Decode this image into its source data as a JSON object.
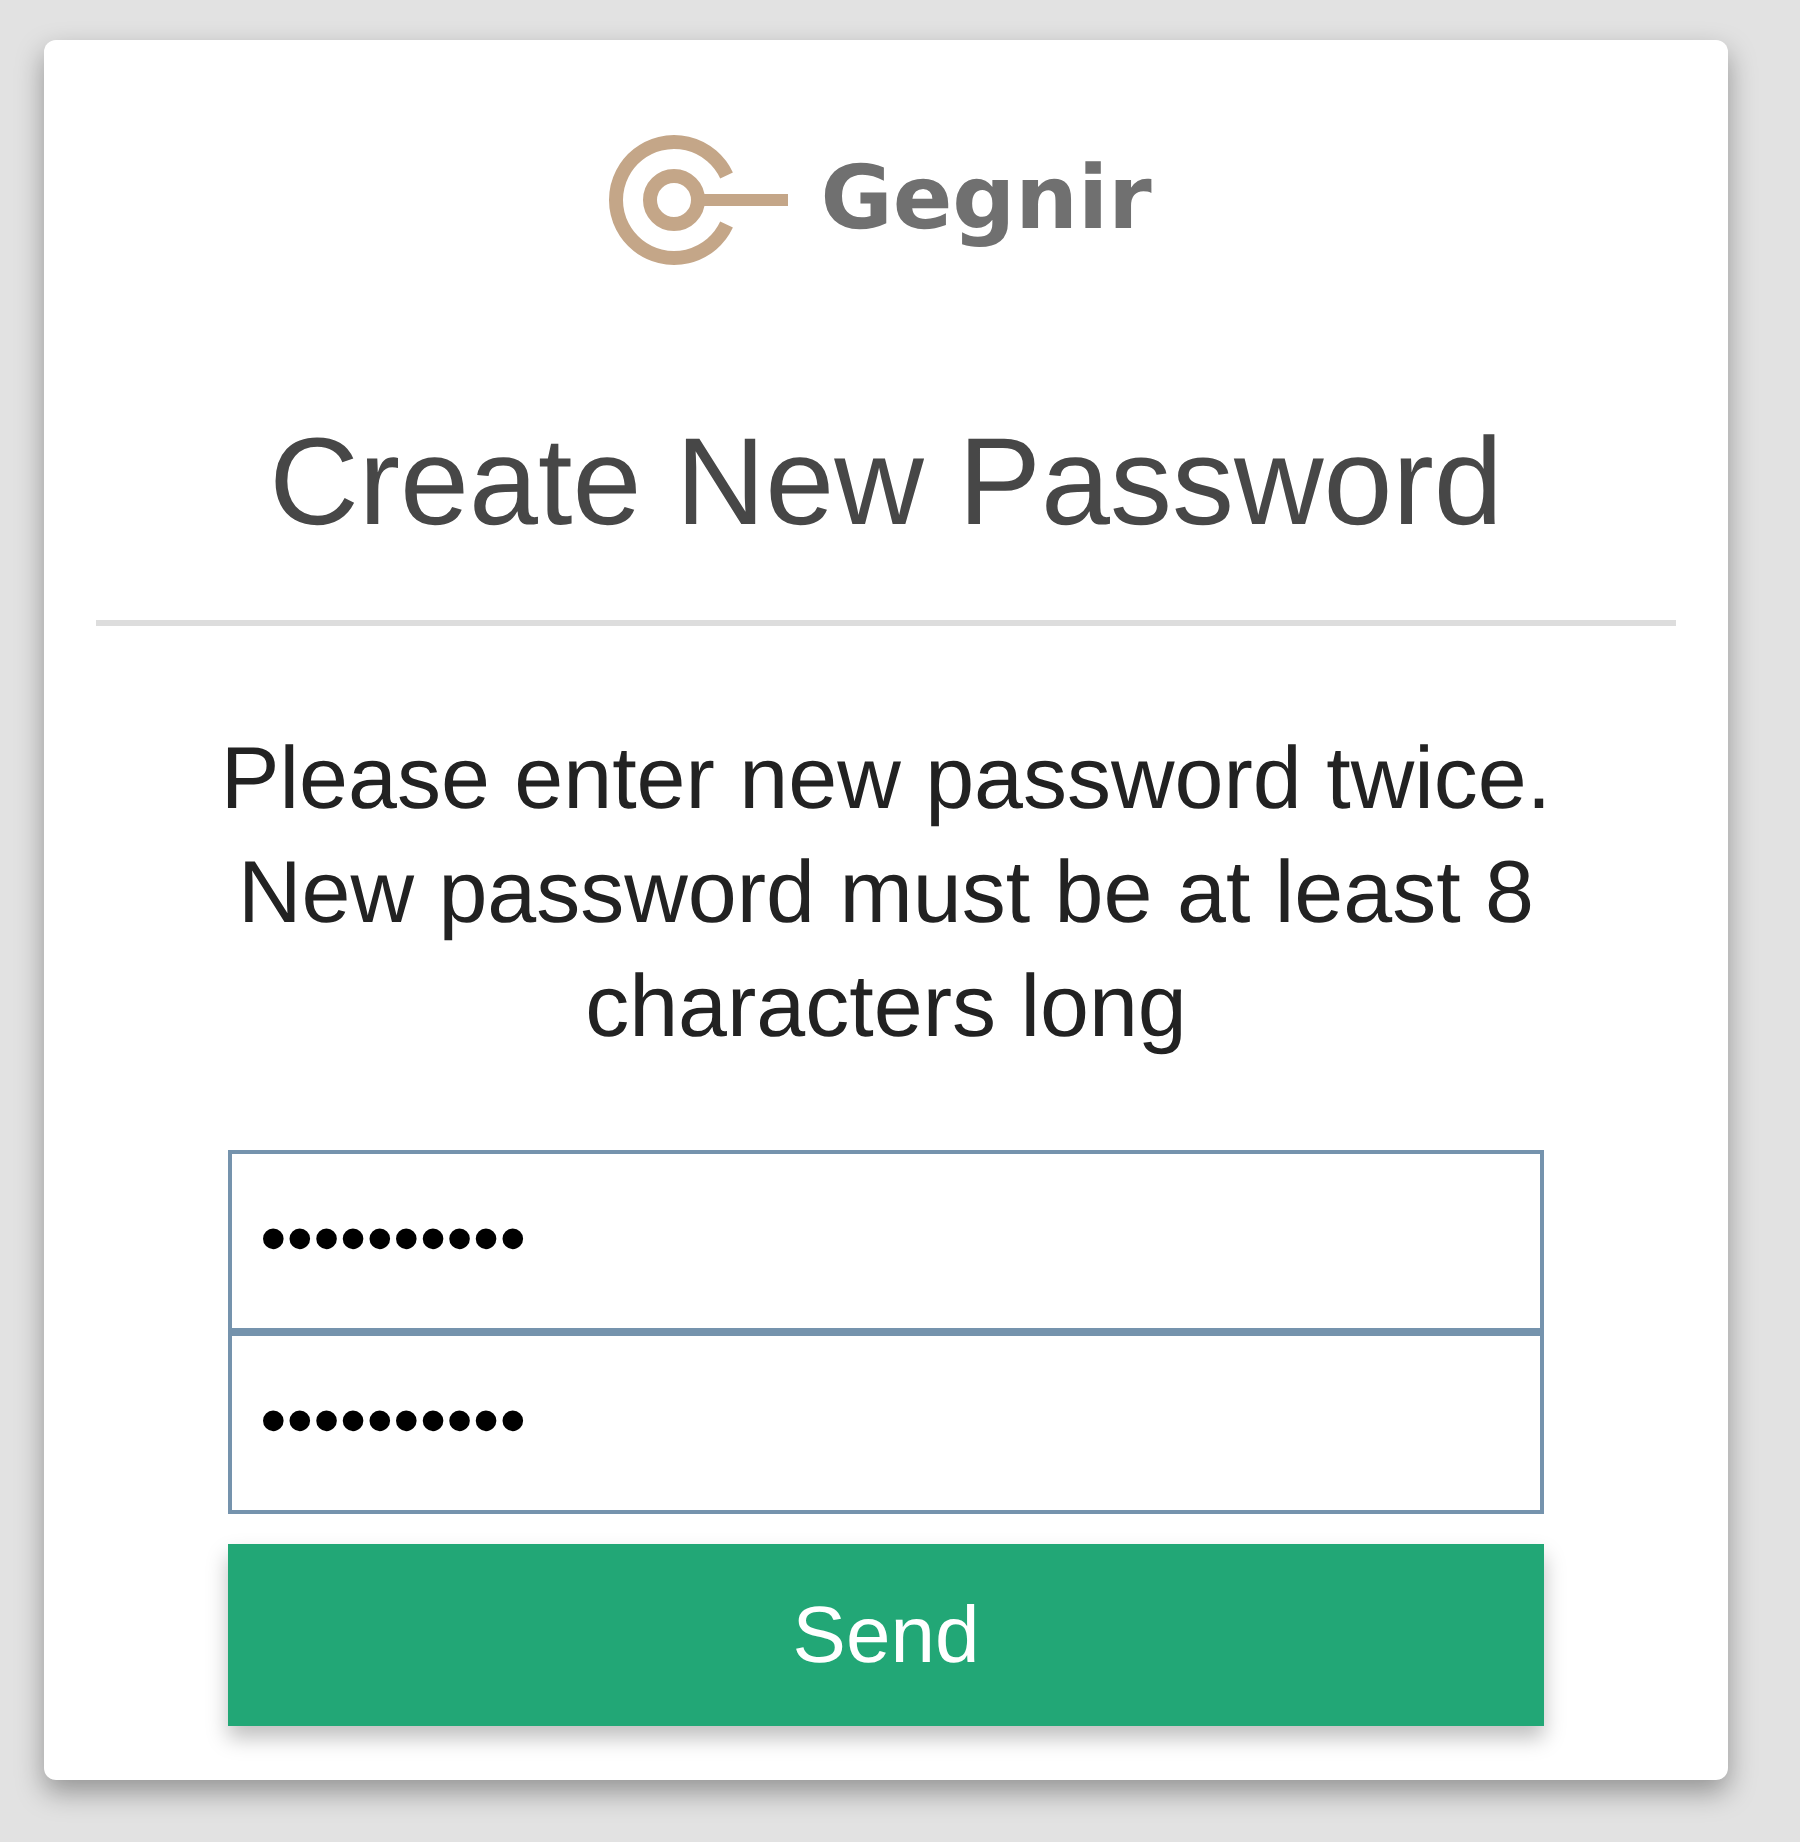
{
  "logo": {
    "name": "Gegnir"
  },
  "title": "Create New Password",
  "instructions": "Please enter new password twice. New password must be at least 8 characters long",
  "fields": [
    {
      "value": "••••••••••"
    },
    {
      "value": "••••••••••"
    }
  ],
  "buttons": [
    {
      "label": "Send"
    }
  ]
}
